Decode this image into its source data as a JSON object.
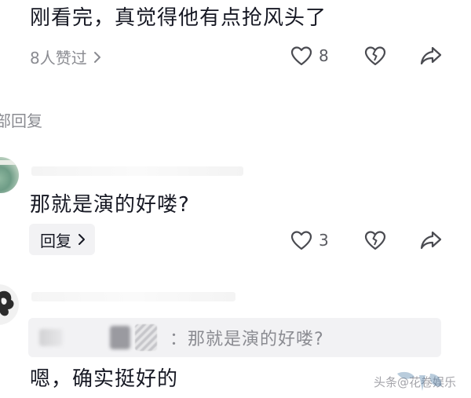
{
  "comment1": {
    "text": "刚看完，真觉得他有点抢风头了",
    "liked_by": "8人赞过",
    "like_count": "8",
    "icons": [
      "heart-icon",
      "broken-heart-icon",
      "share-icon"
    ]
  },
  "collapse_link": "部回复",
  "comment2": {
    "text": "那就是演的好喽?",
    "reply_label": "回复",
    "like_count": "3",
    "icons": [
      "heart-icon",
      "broken-heart-icon",
      "share-icon"
    ]
  },
  "comment3": {
    "quoted_text": "：那就是演的好喽?",
    "text": "嗯，确实挺好的"
  },
  "watermark": {
    "text": "头条@花卷娱乐",
    "logo": "浙江在线水印"
  },
  "colors": {
    "text": "#161823",
    "muted": "#8a8b91",
    "bubble": "#f2f2f4"
  }
}
